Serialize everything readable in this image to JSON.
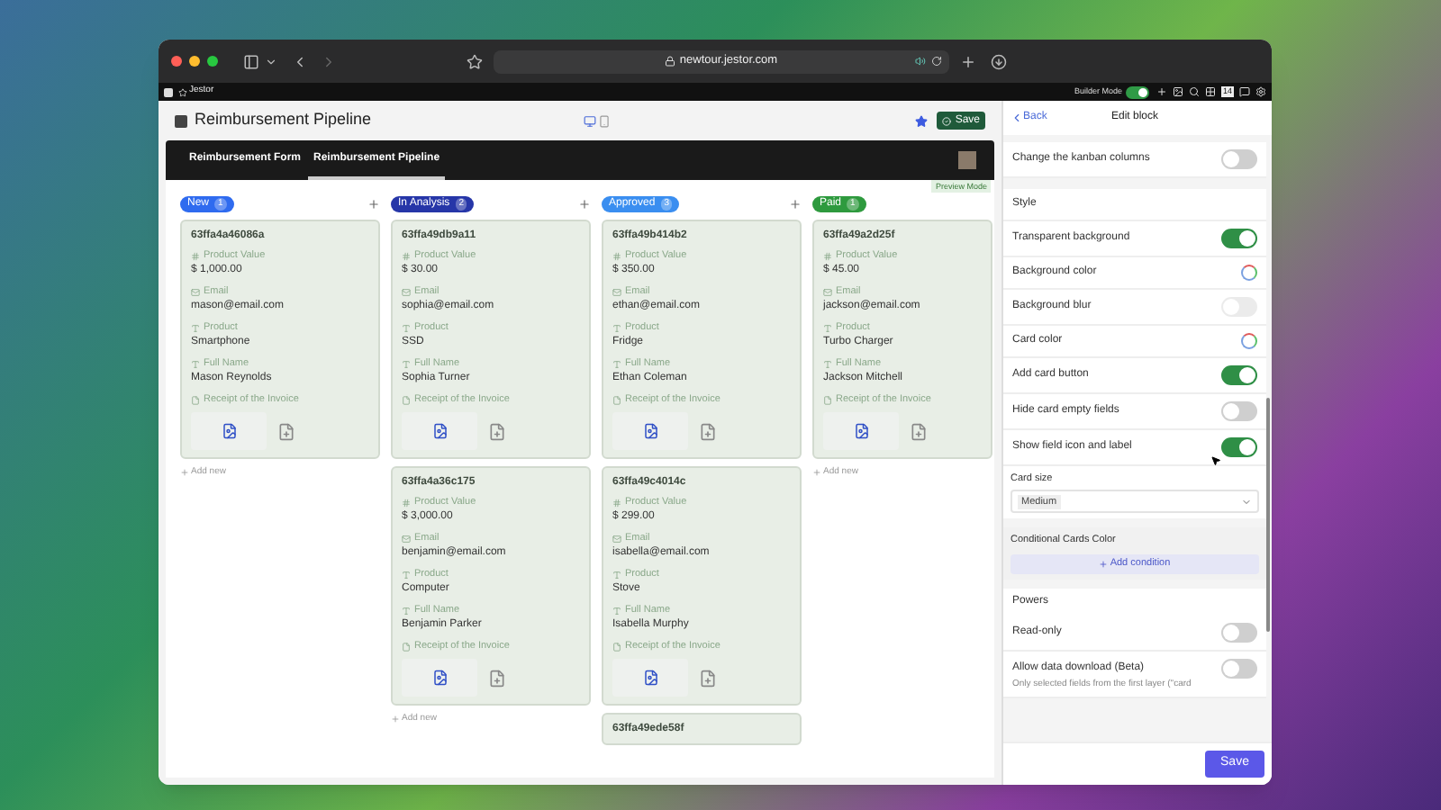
{
  "browser": {
    "url": "newtour.jestor.com"
  },
  "toolbar": {
    "app_name": "Jestor",
    "builder_mode": {
      "label": "Builder Mode",
      "on": true
    },
    "badge": "14"
  },
  "page": {
    "title": "Reimbursement Pipeline",
    "save_label": "Save",
    "tabs": [
      {
        "label": "Reimbursement Form",
        "selected": false
      },
      {
        "label": "Reimbursement Pipeline",
        "selected": true
      }
    ],
    "preview_label": "Preview Mode"
  },
  "columns": [
    {
      "name": "New",
      "count": "1",
      "color": "#2f6bef",
      "add_label": "Add new",
      "cards": [
        {
          "id": "63ffa4a46086a",
          "fields": [
            {
              "kind": "number",
              "label": "Product Value",
              "value": "$ 1,000.00"
            },
            {
              "kind": "email",
              "label": "Email",
              "value": "mason@email.com"
            },
            {
              "kind": "text",
              "label": "Product",
              "value": "Smartphone"
            },
            {
              "kind": "text",
              "label": "Full Name",
              "value": "Mason Reynolds"
            }
          ],
          "attachment_label": "Receipt of the Invoice"
        }
      ]
    },
    {
      "name": "In Analysis",
      "count": "2",
      "color": "#2636a8",
      "add_label": "Add new",
      "cards": [
        {
          "id": "63ffa49db9a11",
          "fields": [
            {
              "kind": "number",
              "label": "Product Value",
              "value": "$ 30.00"
            },
            {
              "kind": "email",
              "label": "Email",
              "value": "sophia@email.com"
            },
            {
              "kind": "text",
              "label": "Product",
              "value": "SSD"
            },
            {
              "kind": "text",
              "label": "Full Name",
              "value": "Sophia Turner"
            }
          ],
          "attachment_label": "Receipt of the Invoice"
        },
        {
          "id": "63ffa4a36c175",
          "fields": [
            {
              "kind": "number",
              "label": "Product Value",
              "value": "$ 3,000.00"
            },
            {
              "kind": "email",
              "label": "Email",
              "value": "benjamin@email.com"
            },
            {
              "kind": "text",
              "label": "Product",
              "value": "Computer"
            },
            {
              "kind": "text",
              "label": "Full Name",
              "value": "Benjamin Parker"
            }
          ],
          "attachment_label": "Receipt of the Invoice"
        }
      ]
    },
    {
      "name": "Approved",
      "count": "3",
      "color": "#3a8ef0",
      "cards": [
        {
          "id": "63ffa49b414b2",
          "fields": [
            {
              "kind": "number",
              "label": "Product Value",
              "value": "$ 350.00"
            },
            {
              "kind": "email",
              "label": "Email",
              "value": "ethan@email.com"
            },
            {
              "kind": "text",
              "label": "Product",
              "value": "Fridge"
            },
            {
              "kind": "text",
              "label": "Full Name",
              "value": "Ethan Coleman"
            }
          ],
          "attachment_label": "Receipt of the Invoice"
        },
        {
          "id": "63ffa49c4014c",
          "fields": [
            {
              "kind": "number",
              "label": "Product Value",
              "value": "$ 299.00"
            },
            {
              "kind": "email",
              "label": "Email",
              "value": "isabella@email.com"
            },
            {
              "kind": "text",
              "label": "Product",
              "value": "Stove"
            },
            {
              "kind": "text",
              "label": "Full Name",
              "value": "Isabella Murphy"
            }
          ],
          "attachment_label": "Receipt of the Invoice"
        },
        {
          "id": "63ffa49ede58f"
        }
      ]
    },
    {
      "name": "Paid",
      "count": "1",
      "color": "#2e9a3e",
      "add_label": "Add new",
      "cards": [
        {
          "id": "63ffa49a2d25f",
          "fields": [
            {
              "kind": "number",
              "label": "Product Value",
              "value": "$ 45.00"
            },
            {
              "kind": "email",
              "label": "Email",
              "value": "jackson@email.com"
            },
            {
              "kind": "text",
              "label": "Product",
              "value": "Turbo Charger"
            },
            {
              "kind": "text",
              "label": "Full Name",
              "value": "Jackson Mitchell"
            }
          ],
          "attachment_label": "Receipt of the Invoice"
        }
      ]
    }
  ],
  "panel": {
    "back_label": "Back",
    "title": "Edit block",
    "top_rows": [
      {
        "kind": "toggle",
        "label": "Change the kanban columns",
        "on": false,
        "disabled": false
      }
    ],
    "style": {
      "title": "Style",
      "rows": [
        {
          "kind": "toggle",
          "label": "Transparent background",
          "on": true,
          "disabled": false
        },
        {
          "kind": "color",
          "label": "Background color"
        },
        {
          "kind": "toggle",
          "label": "Background blur",
          "on": false,
          "disabled": true
        },
        {
          "kind": "color",
          "label": "Card color"
        },
        {
          "kind": "toggle",
          "label": "Add card button",
          "on": true,
          "disabled": false
        },
        {
          "kind": "toggle",
          "label": "Hide card empty fields",
          "on": false,
          "disabled": false
        },
        {
          "kind": "toggle",
          "label": "Show field icon and label",
          "on": true,
          "disabled": false
        }
      ],
      "card_size": {
        "label": "Card size",
        "value": "Medium"
      }
    },
    "conditional": {
      "title": "Conditional Cards Color",
      "button": "Add condition"
    },
    "powers": {
      "title": "Powers",
      "rows": [
        {
          "kind": "toggle",
          "label": "Read-only",
          "on": false,
          "disabled": false
        },
        {
          "kind": "toggle",
          "label": "Allow data download (Beta)",
          "on": false,
          "disabled": false,
          "description": "Only selected fields from the first layer (\"card"
        }
      ]
    },
    "save_label": "Save"
  }
}
